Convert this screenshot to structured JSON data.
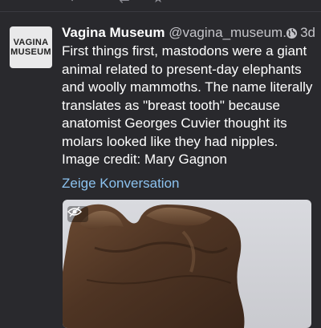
{
  "top_actions": [
    "reply-icon",
    "boost-icon",
    "favourite-icon",
    "share-icon"
  ],
  "status": {
    "avatar_lines": [
      "VAGINA",
      "MUSEUM"
    ],
    "display_name": "Vagina Museum",
    "handle": "@vagina_museum...",
    "time": "3d",
    "visibility_icon": "globe-icon",
    "text_lines": [
      "First things first, mastodons were a giant",
      "animal related to present-day elephants",
      "and woolly mammoths. The name literally",
      "translates as \"breast tooth\" because",
      "anatomist Georges Cuvier thought its",
      "molars looked like they had nipples.",
      "Image credit: Mary Gagnon"
    ],
    "show_conversation": "Zeige Konversation",
    "media_toggle_icon": "eye-slash-icon"
  },
  "colors": {
    "background": "#29292d",
    "link": "#8cc2ef",
    "muted": "#c4c4c9"
  }
}
